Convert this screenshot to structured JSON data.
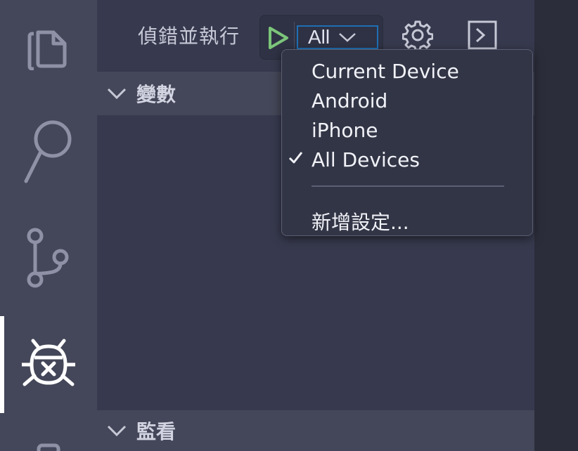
{
  "toolbar": {
    "debug_label": "偵錯並執行",
    "selected_config": "All"
  },
  "sections": {
    "variables": "變數",
    "watch": "監看"
  },
  "dropdown": {
    "items": [
      {
        "label": "Current Device",
        "checked": false
      },
      {
        "label": "Android",
        "checked": false
      },
      {
        "label": "iPhone",
        "checked": false
      },
      {
        "label": "All Devices",
        "checked": true
      }
    ],
    "add_config": "新增設定..."
  },
  "colors": {
    "accent_focus": "#1f6fb5",
    "run_green": "#7cc57a",
    "activity_bar": "#444759",
    "sidebar": "#373a4e"
  },
  "icons": {
    "activity": [
      "explorer-icon",
      "search-icon",
      "source-control-icon",
      "debug-icon",
      "extensions-icon"
    ],
    "toolbar": [
      "run-icon",
      "chevron-down-icon",
      "gear-icon",
      "terminal-icon"
    ]
  }
}
